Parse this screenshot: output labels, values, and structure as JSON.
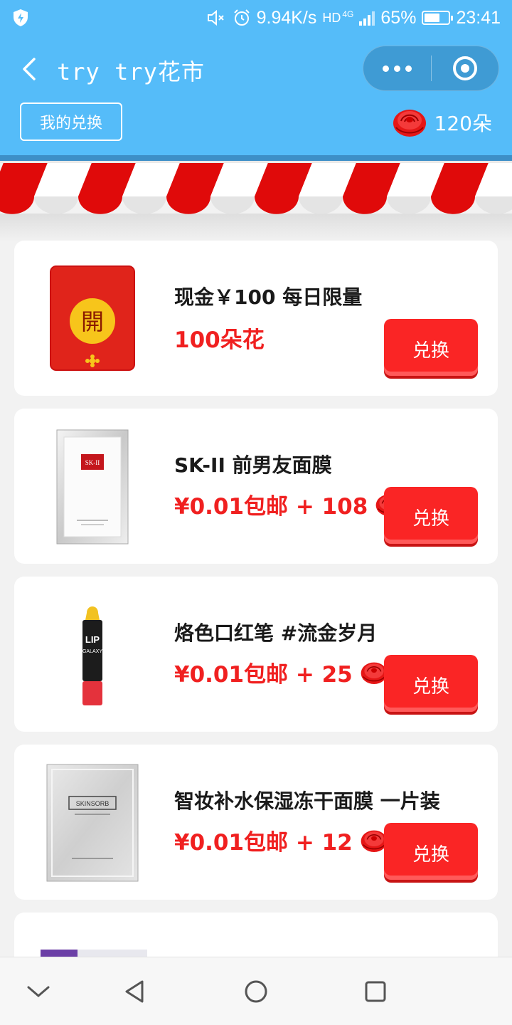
{
  "status_bar": {
    "net_speed": "9.94K/s",
    "hd": "HD",
    "network": "4G",
    "battery": "65%",
    "battery_level": 0.65,
    "time": "23:41"
  },
  "navbar": {
    "title": "try try花市",
    "my_exchange_label": "我的兑换",
    "flower_balance": "120朵"
  },
  "colors": {
    "header_bg": "#55bcf9",
    "awning_red": "#e00a0a",
    "price_red": "#f02020",
    "button_red": "#fa2525"
  },
  "products": [
    {
      "name": "现金￥100 每日限量",
      "price": "100朵花",
      "show_flower": false,
      "button": "兑换",
      "thumb": "red-envelope-icon",
      "thumb_char": "開"
    },
    {
      "name": "SK-II 前男友面膜",
      "price": "¥0.01包邮 + 108",
      "show_flower": true,
      "button": "兑换",
      "thumb": "face-mask-skii",
      "brand": "SK-II"
    },
    {
      "name": "烙色口红笔 #流金岁月",
      "price": "¥0.01包邮 + 25",
      "show_flower": true,
      "button": "兑换",
      "thumb": "lipstick-pen",
      "brand": "LIP GALAXY"
    },
    {
      "name": "智妆补水保湿冻干面膜 一片装",
      "price": "¥0.01包邮 + 12",
      "show_flower": true,
      "button": "兑换",
      "thumb": "face-mask-skinsorb",
      "brand": "SKINSORB"
    }
  ]
}
